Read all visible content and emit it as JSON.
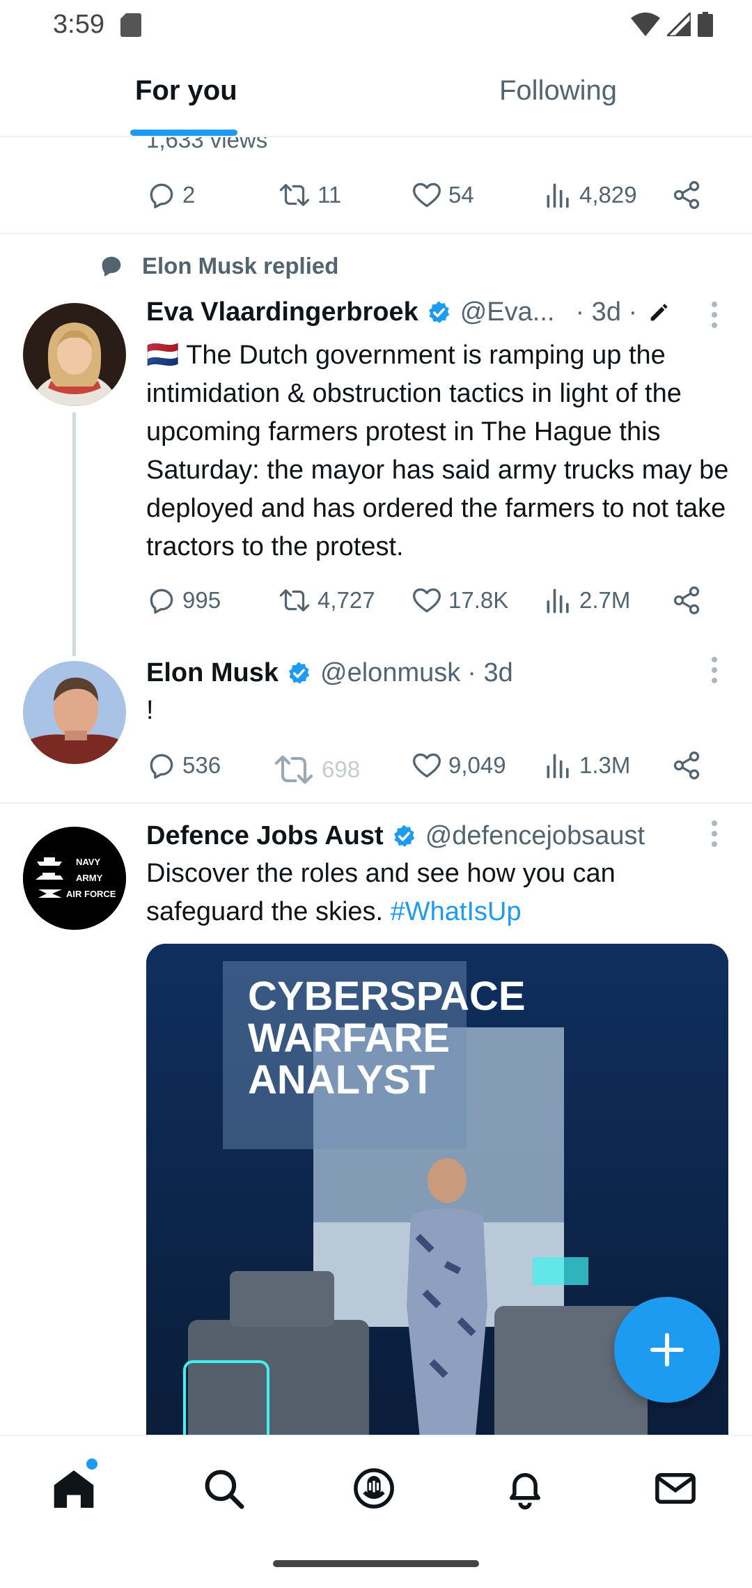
{
  "status_bar": {
    "time": "3:59"
  },
  "tabs": [
    {
      "label": "For you",
      "active": true
    },
    {
      "label": "Following",
      "active": false
    }
  ],
  "prev_tweet": {
    "views_text": "1,633 views",
    "reply_count": "2",
    "retweet_count": "11",
    "like_count": "54",
    "view_count": "4,829"
  },
  "context": {
    "label": "Elon Musk replied"
  },
  "tweet1": {
    "name": "Eva Vlaardingerbroek",
    "handle": "@Eva...",
    "time": "· 3d ·",
    "text": "🇳🇱 The Dutch government is ramping up the intimidation & obstruction tactics in light of the upcoming farmers protest in The Hague this Saturday: the mayor has said army trucks may be deployed and has ordered the farmers to not take tractors to the protest.",
    "reply_count": "995",
    "retweet_count": "4,727",
    "like_count": "17.8K",
    "view_count": "2.7M"
  },
  "tweet2": {
    "name": "Elon Musk",
    "handle": "@elonmusk",
    "time": "· 3d",
    "text": "!",
    "reply_count": "536",
    "retweet_count": "698",
    "like_count": "9,049",
    "view_count": "1.3M"
  },
  "tweet3": {
    "name": "Defence Jobs Aust",
    "handle": "@defencejobsaust",
    "text": "Discover the roles and see how you can safeguard the skies.",
    "hashtag": "#WhatIsUp",
    "avatar_lines": [
      "NAVY",
      "ARMY",
      "AIR FORCE"
    ],
    "media_lines": [
      "CYBERSPACE",
      "WARFARE",
      "ANALYST"
    ]
  },
  "icons": {
    "reply": "reply-icon",
    "retweet": "retweet-icon",
    "like": "like-icon",
    "views": "views-icon",
    "share": "share-icon",
    "compose": "compose-plus-icon",
    "nav": [
      "home-icon",
      "search-icon",
      "spaces-icon",
      "notifications-icon",
      "messages-icon"
    ]
  },
  "colors": {
    "accent": "#1d9bf0",
    "text": "#0f1419",
    "secondary": "#536471"
  }
}
